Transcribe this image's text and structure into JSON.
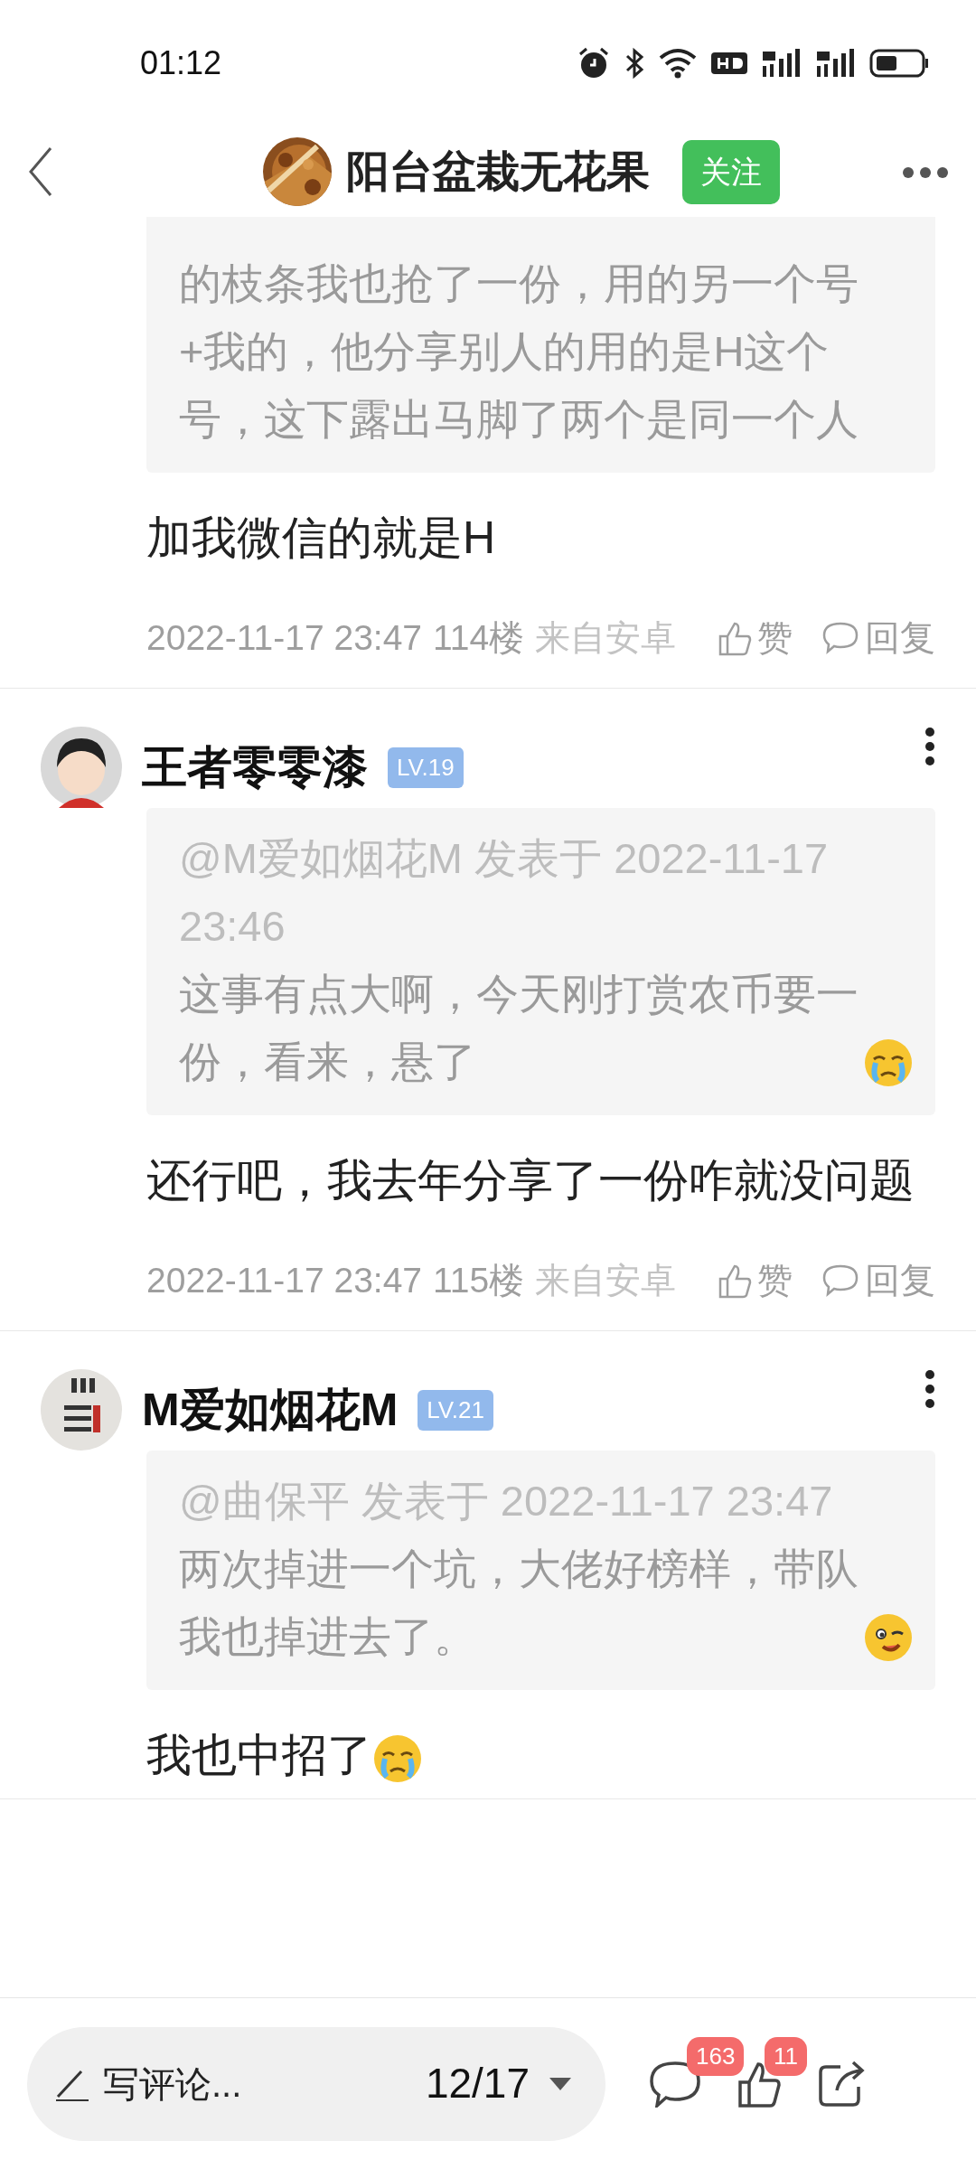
{
  "status_bar": {
    "time": "01:12"
  },
  "header": {
    "title": "阳台盆栽无花果",
    "follow_label": "关注"
  },
  "posts": [
    {
      "quote": {
        "body": "的枝条我也抢了一份，用的另一个号+我的，他分享别人的用的是H这个号，这下露出马脚了两个是同一个人"
      },
      "text": "加我微信的就是H",
      "footer": {
        "date": "2022-11-17 23:47",
        "floor": "114楼",
        "source": "来自安卓",
        "like_label": "赞",
        "reply_label": "回复"
      }
    },
    {
      "author": {
        "name": "王者零零漆",
        "level": "LV.19"
      },
      "quote": {
        "header": "@M爱如烟花M 发表于 2022-11-17 23:46",
        "body": "这事有点大啊，今天刚打赏农币要一份，看来，悬了",
        "emoji": {
          "kind": "crying"
        }
      },
      "text": "还行吧，我去年分享了一份咋就没问题",
      "footer": {
        "date": "2022-11-17 23:47",
        "floor": "115楼",
        "source": "来自安卓",
        "like_label": "赞",
        "reply_label": "回复"
      }
    },
    {
      "author": {
        "name": "M爱如烟花M",
        "level": "LV.21"
      },
      "quote": {
        "header": "@曲保平 发表于 2022-11-17 23:47",
        "body": "两次掉进一个坑，大佬好榜样，带队我也掉进去了。",
        "emoji": {
          "kind": "wink"
        }
      },
      "text": "我也中招了",
      "text_emoji": {
        "kind": "crying"
      }
    }
  ],
  "bottom_bar": {
    "placeholder": "写评论...",
    "page": "12/17",
    "comment_count": "163",
    "like_count": "11"
  }
}
